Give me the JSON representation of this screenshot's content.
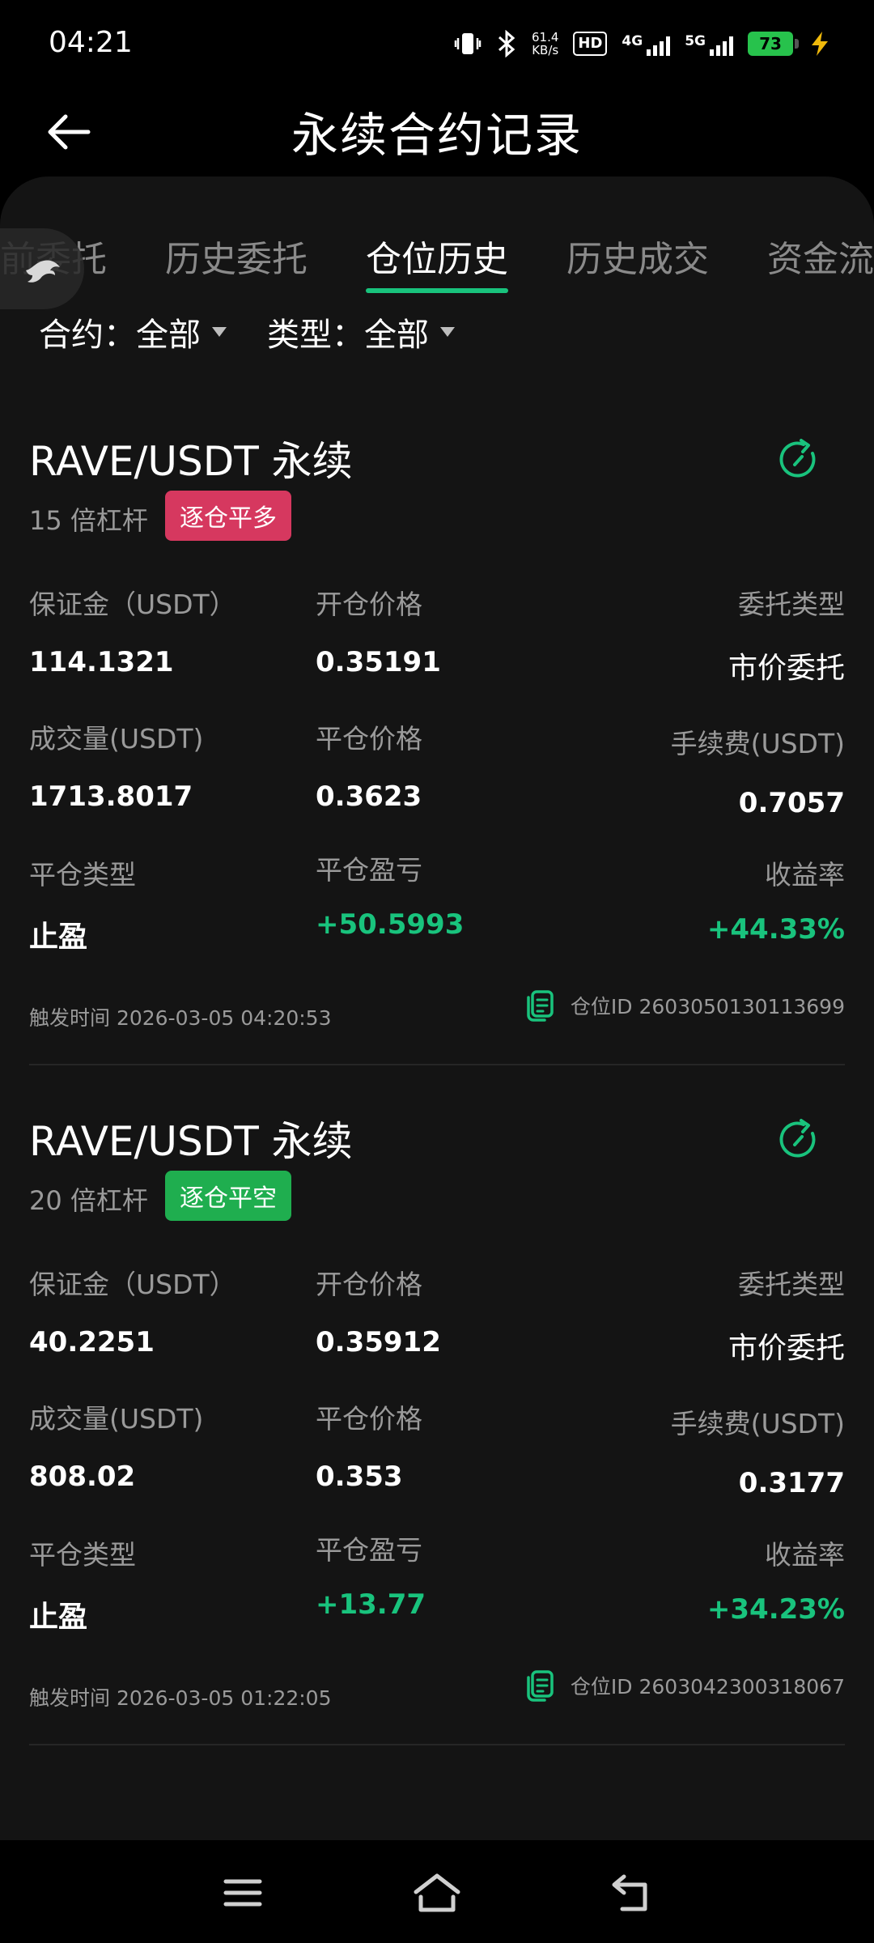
{
  "status_bar": {
    "time": "04:21",
    "net_speed_value": "61.4",
    "net_speed_unit": "KB/s",
    "hd_label": "HD",
    "net1": "4G",
    "net2": "5G",
    "battery": "73"
  },
  "header": {
    "title": "永续合约记录"
  },
  "tabs": [
    {
      "label": "前委托"
    },
    {
      "label": "历史委托"
    },
    {
      "label": "仓位历史",
      "active": true
    },
    {
      "label": "历史成交"
    },
    {
      "label": "资金流"
    }
  ],
  "filters": {
    "contract": "合约：全部",
    "type": "类型：全部"
  },
  "labels": {
    "margin": "保证金（USDT）",
    "open_price": "开仓价格",
    "order_type": "委托类型",
    "volume": "成交量(USDT)",
    "close_price": "平仓价格",
    "fee": "手续费(USDT)",
    "close_type": "平仓类型",
    "pnl": "平仓盈亏",
    "roi": "收益率",
    "trigger_time": "触发时间",
    "position_id": "仓位ID"
  },
  "records": [
    {
      "title": "RAVE/USDT 永续",
      "leverage": "15 倍杠杆",
      "badge": "逐仓平多",
      "badge_color": "#d6385f",
      "margin": "114.1321",
      "open_price": "0.35191",
      "order_type": "市价委托",
      "volume": "1713.8017",
      "close_price": "0.3623",
      "fee": "0.7057",
      "close_type": "止盈",
      "pnl": "+50.5993",
      "roi": "+44.33%",
      "trigger_time": "2026-03-05 04:20:53",
      "position_id": "2603050130113699"
    },
    {
      "title": "RAVE/USDT 永续",
      "leverage": "20 倍杠杆",
      "badge": "逐仓平空",
      "badge_color": "#1fae4f",
      "margin": "40.2251",
      "open_price": "0.35912",
      "order_type": "市价委托",
      "volume": "808.02",
      "close_price": "0.353",
      "fee": "0.3177",
      "close_type": "止盈",
      "pnl": "+13.77",
      "roi": "+34.23%",
      "trigger_time": "2026-03-05 01:22:05",
      "position_id": "2603042300318067"
    }
  ],
  "colors": {
    "accent_green": "#19c37d",
    "background": "#141414"
  }
}
